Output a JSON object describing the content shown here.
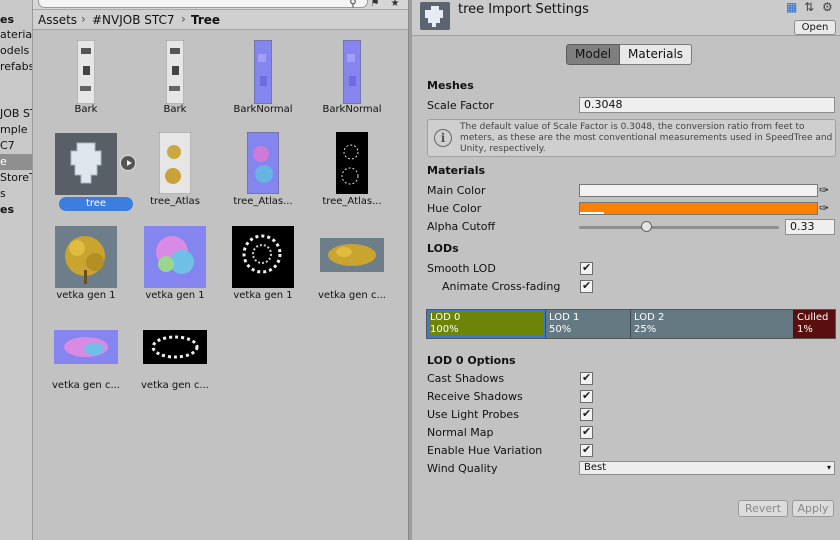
{
  "sidebar": {
    "items": [
      {
        "label": "es",
        "bold": true
      },
      {
        "label": "aterials",
        "bold": false
      },
      {
        "label": "odels",
        "bold": false
      },
      {
        "label": "refabs",
        "bold": false
      },
      {
        "label": "",
        "bold": false
      },
      {
        "label": "JOB ST",
        "bold": false
      },
      {
        "label": "mple",
        "bold": false
      },
      {
        "label": "C7",
        "bold": false
      },
      {
        "label": "e",
        "bold": false,
        "selected": true
      },
      {
        "label": "StoreT",
        "bold": false
      },
      {
        "label": "s",
        "bold": false
      },
      {
        "label": "es",
        "bold": true
      }
    ]
  },
  "browser": {
    "breadcrumb": [
      "Assets",
      "#NVJOB STC7",
      "Tree"
    ],
    "assets": [
      {
        "label": "Bark",
        "kind": "bark"
      },
      {
        "label": "Bark",
        "kind": "bark"
      },
      {
        "label": "BarkNormal",
        "kind": "barknormal"
      },
      {
        "label": "BarkNormal",
        "kind": "barknormal"
      },
      {
        "label": "tree",
        "kind": "tree",
        "selected": true
      },
      {
        "label": "tree_Atlas",
        "kind": "atlas"
      },
      {
        "label": "tree_Atlas...",
        "kind": "atlasnormal"
      },
      {
        "label": "tree_Atlas...",
        "kind": "atlasmask"
      },
      {
        "label": "vetka gen 1",
        "kind": "vetkacolor"
      },
      {
        "label": "vetka gen 1",
        "kind": "vetkanormal"
      },
      {
        "label": "vetka gen 1",
        "kind": "vetkamask"
      },
      {
        "label": "vetka gen c...",
        "kind": "vetkawide"
      },
      {
        "label": "vetka gen c...",
        "kind": "vetkanormalwide"
      },
      {
        "label": "vetka gen c...",
        "kind": "vetkamaskwide"
      }
    ]
  },
  "inspector": {
    "title": "tree Import Settings",
    "open_label": "Open",
    "tabs": [
      "Model",
      "Materials"
    ],
    "meshes": {
      "title": "Meshes",
      "scale_label": "Scale Factor",
      "scale_value": "0.3048",
      "help": "The default value of Scale Factor is 0.3048, the conversion ratio from feet to meters, as these are the most conventional measurements used in SpeedTree and Unity, respectively."
    },
    "materials": {
      "title": "Materials",
      "main_color_label": "Main Color",
      "main_color": "#f2f2f2",
      "hue_color_label": "Hue Color",
      "hue_color": "#ff8000",
      "alpha_label": "Alpha Cutoff",
      "alpha_value": "0.33"
    },
    "lods": {
      "title": "LODs",
      "smooth_label": "Smooth LOD",
      "animate_label": "Animate Cross-fading",
      "bar": [
        {
          "name": "LOD 0",
          "pct": "100%",
          "color": "#6e8409"
        },
        {
          "name": "LOD 1",
          "pct": "50%",
          "color": "#657983"
        },
        {
          "name": "LOD 2",
          "pct": "25%",
          "color": "#657983"
        },
        {
          "name": "Culled",
          "pct": "1%",
          "color": "#5a0f0f"
        }
      ]
    },
    "lod0": {
      "title": "LOD 0 Options",
      "options": [
        "Cast Shadows",
        "Receive Shadows",
        "Use Light Probes",
        "Normal Map",
        "Enable Hue Variation"
      ],
      "wind_label": "Wind Quality",
      "wind_value": "Best"
    },
    "buttons": {
      "revert": "Revert",
      "apply": "Apply"
    }
  }
}
